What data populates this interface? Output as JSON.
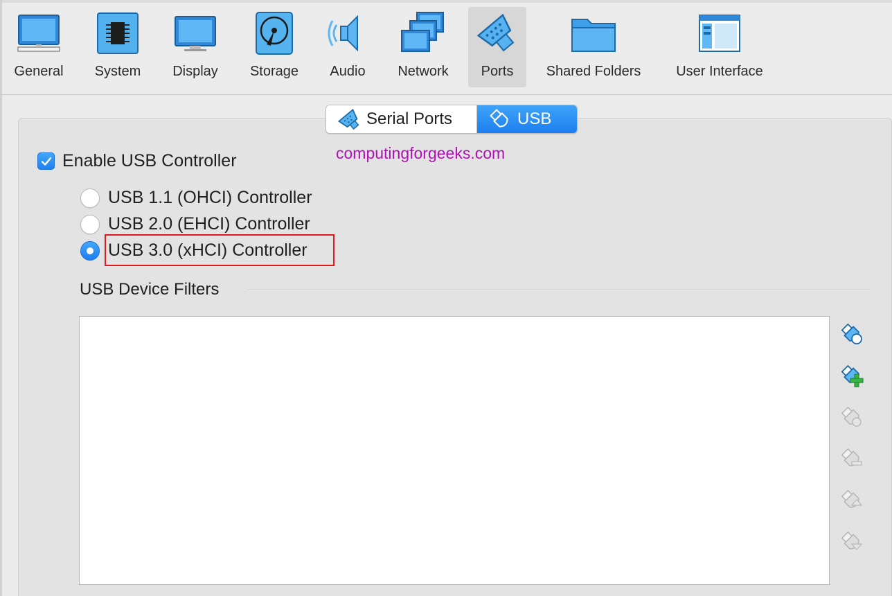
{
  "toolbar": {
    "items": [
      {
        "label": "General",
        "icon": "general-icon"
      },
      {
        "label": "System",
        "icon": "system-icon"
      },
      {
        "label": "Display",
        "icon": "display-icon"
      },
      {
        "label": "Storage",
        "icon": "storage-icon"
      },
      {
        "label": "Audio",
        "icon": "audio-icon"
      },
      {
        "label": "Network",
        "icon": "network-icon"
      },
      {
        "label": "Ports",
        "icon": "ports-icon",
        "selected": true
      },
      {
        "label": "Shared Folders",
        "icon": "shared-folders-icon"
      },
      {
        "label": "User Interface",
        "icon": "user-interface-icon"
      }
    ]
  },
  "tabs": {
    "items": [
      {
        "label": "Serial Ports",
        "icon": "serial-port-icon",
        "selected": false
      },
      {
        "label": "USB",
        "icon": "usb-icon",
        "selected": true
      }
    ]
  },
  "watermark": "computingforgeeks.com",
  "usb": {
    "enable_label": "Enable USB Controller",
    "enable_checked": true,
    "controllers": [
      {
        "label": "USB 1.1 (OHCI) Controller",
        "selected": false
      },
      {
        "label": "USB 2.0 (EHCI) Controller",
        "selected": false
      },
      {
        "label": "USB 3.0 (xHCI) Controller",
        "selected": true
      }
    ],
    "filters_label": "USB Device Filters",
    "filter_actions": [
      {
        "icon": "add-empty-filter-icon",
        "enabled": true
      },
      {
        "icon": "add-device-filter-icon",
        "enabled": true
      },
      {
        "icon": "edit-filter-icon",
        "enabled": false
      },
      {
        "icon": "remove-filter-icon",
        "enabled": false
      },
      {
        "icon": "move-filter-up-icon",
        "enabled": false
      },
      {
        "icon": "move-filter-down-icon",
        "enabled": false
      }
    ]
  },
  "colors": {
    "accent": "#1c7ff0",
    "watermark": "#b10fb8",
    "highlight": "#e0191c"
  }
}
